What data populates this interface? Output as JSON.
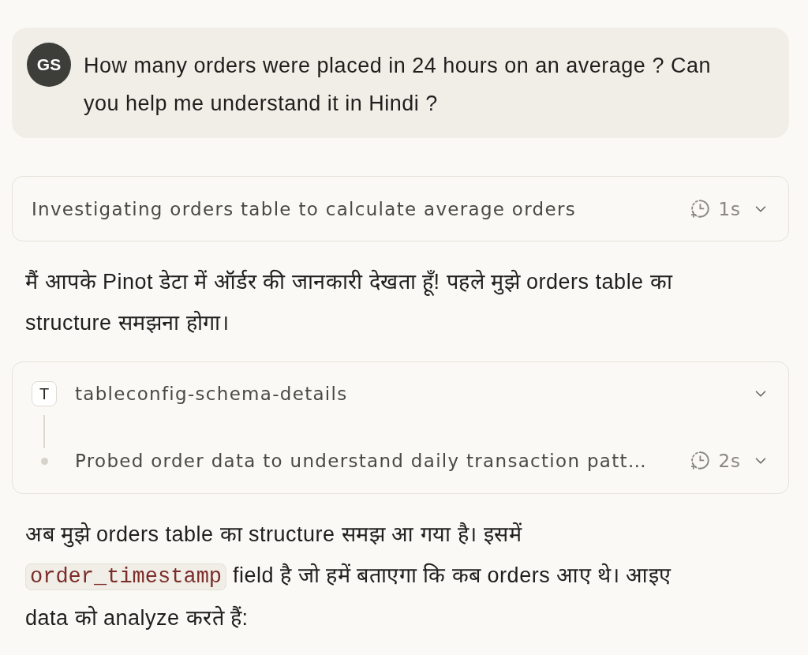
{
  "user_message": {
    "avatar": "GS",
    "text": "How many orders were placed in 24 hours on an average ? Can you help me understand it in Hindi ?"
  },
  "messages": [
    {
      "kind": "step",
      "label": "Investigating orders table to calculate average orders",
      "duration": "1s",
      "expanded": false
    },
    {
      "kind": "paragraph",
      "segments": [
        {
          "kind": "text",
          "text": "मैं आपके Pinot डेटा में ऑर्डर की जानकारी देखता हूँ! पहले मुझे orders table का structure समझना होगा।"
        }
      ]
    },
    {
      "kind": "tool_group",
      "items": [
        {
          "kind": "tool",
          "initial": "T",
          "label": "tableconfig-schema-details",
          "expanded": false
        },
        {
          "kind": "step",
          "label": "Probed order data to understand daily transaction patt…",
          "duration": "2s",
          "expanded": false
        }
      ]
    },
    {
      "kind": "paragraph",
      "segments": [
        {
          "kind": "text",
          "text": "अब मुझे orders table का structure समझ आ गया है। इसमें"
        },
        {
          "kind": "code",
          "text": "order_timestamp"
        },
        {
          "kind": "text",
          "text": "field है जो हमें बताएगा कि कब orders आए थे। आइए data को analyze करते हैं:"
        }
      ]
    }
  ]
}
